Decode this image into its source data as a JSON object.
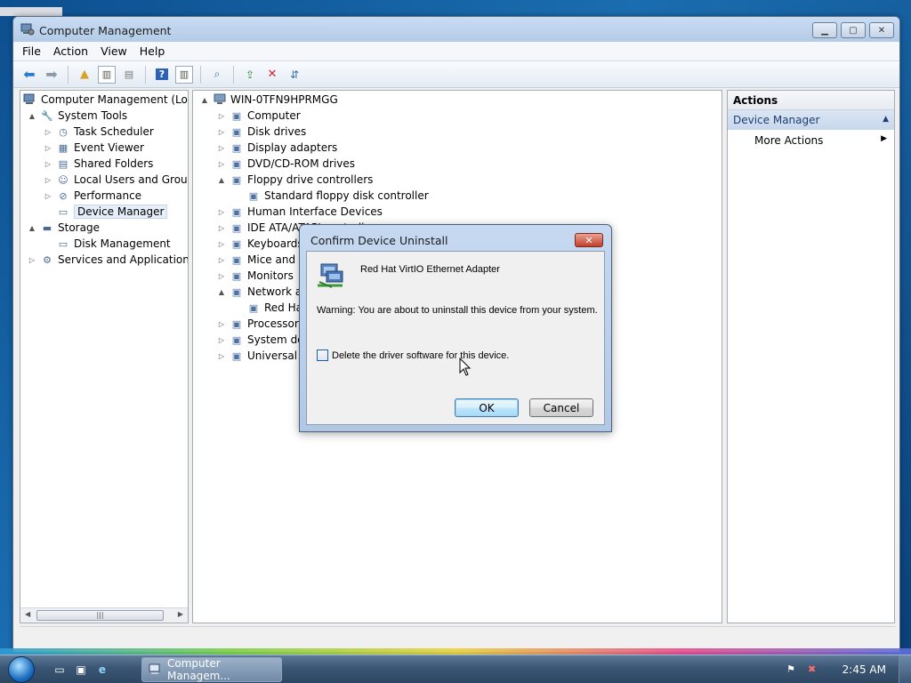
{
  "window": {
    "title": "Computer Management",
    "buttons": {
      "minimize": "▁",
      "maximize": "▢",
      "close": "✕"
    }
  },
  "menu": [
    "File",
    "Action",
    "View",
    "Help"
  ],
  "left_tree": {
    "root": "Computer Management (Local)",
    "items": [
      {
        "label": "System Tools",
        "icon": "tools-icon",
        "level": 1,
        "twisty": "▲"
      },
      {
        "label": "Task Scheduler",
        "icon": "clock-icon",
        "level": 2,
        "twisty": "▷"
      },
      {
        "label": "Event Viewer",
        "icon": "event-viewer-icon",
        "level": 2,
        "twisty": "▷"
      },
      {
        "label": "Shared Folders",
        "icon": "shared-folder-icon",
        "level": 2,
        "twisty": "▷"
      },
      {
        "label": "Local Users and Groups",
        "icon": "users-icon",
        "level": 2,
        "twisty": "▷"
      },
      {
        "label": "Performance",
        "icon": "performance-icon",
        "level": 2,
        "twisty": "▷"
      },
      {
        "label": "Device Manager",
        "icon": "device-manager-icon",
        "level": 2,
        "twisty": ""
      },
      {
        "label": "Storage",
        "icon": "storage-icon",
        "level": 1,
        "twisty": "▲"
      },
      {
        "label": "Disk Management",
        "icon": "disk-icon",
        "level": 2,
        "twisty": ""
      },
      {
        "label": "Services and Applications",
        "icon": "services-icon",
        "level": 1,
        "twisty": "▷"
      }
    ]
  },
  "device_tree": {
    "root": "WIN-0TFN9HPRMGG",
    "items": [
      {
        "label": "Computer",
        "level": 1,
        "twisty": "▷"
      },
      {
        "label": "Disk drives",
        "level": 1,
        "twisty": "▷"
      },
      {
        "label": "Display adapters",
        "level": 1,
        "twisty": "▷"
      },
      {
        "label": "DVD/CD-ROM drives",
        "level": 1,
        "twisty": "▷"
      },
      {
        "label": "Floppy drive controllers",
        "level": 1,
        "twisty": "▲"
      },
      {
        "label": "Standard floppy disk controller",
        "level": 2,
        "twisty": ""
      },
      {
        "label": "Human Interface Devices",
        "level": 1,
        "twisty": "▷"
      },
      {
        "label": "IDE ATA/ATAPI controllers",
        "level": 1,
        "twisty": "▷"
      },
      {
        "label": "Keyboards",
        "level": 1,
        "twisty": "▷"
      },
      {
        "label": "Mice and other pointing devices",
        "level": 1,
        "twisty": "▷"
      },
      {
        "label": "Monitors",
        "level": 1,
        "twisty": "▷"
      },
      {
        "label": "Network adapters",
        "level": 1,
        "twisty": "▲"
      },
      {
        "label": "Red Hat VirtIO Ethernet Adapter",
        "level": 2,
        "twisty": ""
      },
      {
        "label": "Processors",
        "level": 1,
        "twisty": "▷"
      },
      {
        "label": "System devices",
        "level": 1,
        "twisty": "▷"
      },
      {
        "label": "Universal Serial Bus controllers",
        "level": 1,
        "twisty": "▷"
      }
    ]
  },
  "actions": {
    "header": "Actions",
    "section": "Device Manager",
    "more": "More Actions"
  },
  "dialog": {
    "title": "Confirm Device Uninstall",
    "device_name": "Red Hat VirtIO Ethernet Adapter",
    "warning": "Warning: You are about to uninstall this device from your system.",
    "checkbox_label": "Delete the driver software for this device.",
    "ok": "OK",
    "cancel": "Cancel"
  },
  "taskbar": {
    "active_task": "Computer Managem...",
    "clock": "2:45 AM"
  },
  "scroll_thumb": "|||"
}
